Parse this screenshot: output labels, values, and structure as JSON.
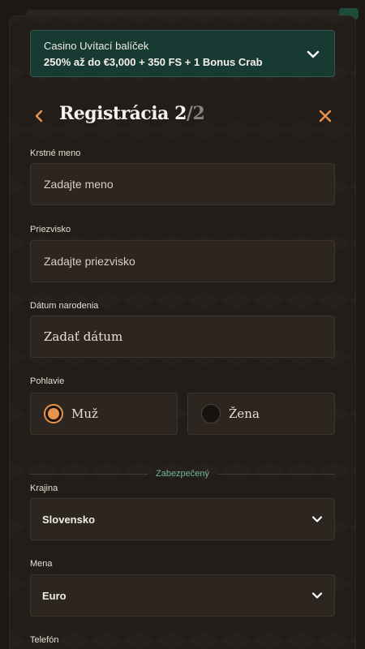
{
  "promo": {
    "title": "Casino Uvítací balíček",
    "offer": "250% až do €3,000 + 350 FS + 1 Bonus Crab"
  },
  "header": {
    "title": "Registrácia 2",
    "step_sep": "/",
    "step_total": "2"
  },
  "form": {
    "first_name": {
      "label": "Krstné meno",
      "placeholder": "Zadajte meno"
    },
    "last_name": {
      "label": "Priezvisko",
      "placeholder": "Zadajte priezvisko"
    },
    "birth_date": {
      "label": "Dátum narodenia",
      "placeholder": "Zadať dátum"
    },
    "gender": {
      "label": "Pohlavie",
      "options": [
        {
          "label": "Muž",
          "selected": true
        },
        {
          "label": "Žena",
          "selected": false
        }
      ]
    },
    "divider": "Zabezpečený",
    "country": {
      "label": "Krajina",
      "value": "Slovensko"
    },
    "currency": {
      "label": "Mena",
      "value": "Euro"
    },
    "phone": {
      "label": "Telefón"
    }
  },
  "colors": {
    "accent": "#e8944a",
    "promo_bg": "#173a32",
    "secure": "#6fb5a1"
  },
  "icons": {
    "promo_toggle": "chevron-down-icon",
    "back": "chevron-left-icon",
    "close": "close-icon",
    "select": "chevron-down-icon"
  }
}
